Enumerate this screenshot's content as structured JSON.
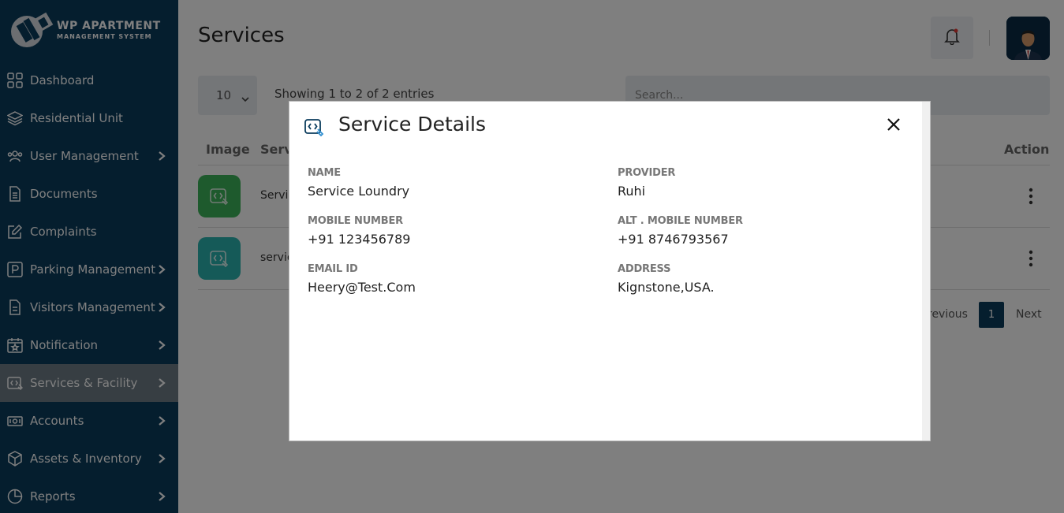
{
  "app": {
    "logo_title": "WP APARTMENT",
    "logo_subtitle": "MANAGEMENT SYSTEM"
  },
  "sidebar": {
    "items": [
      {
        "label": "Dashboard",
        "icon": "dashboard-icon"
      },
      {
        "label": "Residential Unit",
        "icon": "layers-icon"
      },
      {
        "label": "User Management",
        "icon": "users-icon"
      },
      {
        "label": "Documents",
        "icon": "document-icon"
      },
      {
        "label": "Complaints",
        "icon": "edit-icon"
      },
      {
        "label": "Parking Management",
        "icon": "parking-icon"
      },
      {
        "label": "Visitors Management",
        "icon": "clipboard-icon"
      },
      {
        "label": "Notification",
        "icon": "calendar-star-icon"
      },
      {
        "label": "Services & Facility",
        "icon": "service-icon"
      },
      {
        "label": "Accounts",
        "icon": "money-icon"
      },
      {
        "label": "Assets & Inventory",
        "icon": "box-icon"
      },
      {
        "label": "Reports",
        "icon": "pie-chart-icon"
      }
    ],
    "active": "Services & Facility"
  },
  "header": {
    "title": "Services"
  },
  "table_controls": {
    "length_value": "10",
    "showing_text": "Showing 1 to 2 of 2 entries",
    "search_placeholder": "Search..."
  },
  "table": {
    "headers": {
      "image": "Image",
      "service": "Servi",
      "action": "Action"
    },
    "rows": [
      {
        "name_partial": "Servic",
        "color": "#3cb55a"
      },
      {
        "name_partial": "servic",
        "color": "#2bb5b0"
      }
    ]
  },
  "pagination": {
    "prev": "revious",
    "current": "1",
    "next": "Next"
  },
  "modal": {
    "title": "Service Details",
    "fields": {
      "name_label": "NAME",
      "name_value": "Service Loundry",
      "provider_label": "PROVIDER",
      "provider_value": "Ruhi",
      "mobile_label": "MOBILE NUMBER",
      "mobile_value": "+91 123456789",
      "alt_mobile_label": "ALT . MOBILE NUMBER",
      "alt_mobile_value": "+91 8746793567",
      "email_label": "EMAIL ID",
      "email_value": "Heery@Test.Com",
      "address_label": "ADDRESS",
      "address_value": "Kignstone,USA."
    }
  },
  "colors": {
    "sidebar_bg": "#0b3c5d",
    "active_item_bg": "#6e7c86",
    "accent": "#0b3c5d",
    "row1_icon_bg": "#3cb55a",
    "row2_icon_bg": "#2bb5b0"
  }
}
